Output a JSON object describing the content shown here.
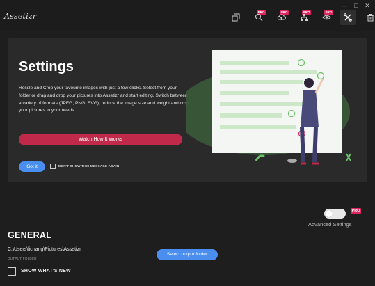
{
  "titlebar": {
    "logo": "Assetizr",
    "window_controls": {
      "minimize": "–",
      "maximize": "□",
      "close": "✕"
    },
    "pro_badge": "PRO",
    "icons": [
      "resize-icon",
      "search-optimize-icon",
      "cloud-upload-icon",
      "hierarchy-icon",
      "watermark-eye-icon",
      "tools-icon",
      "trash-icon"
    ]
  },
  "settings_card": {
    "title": "Settings",
    "description": "Resize and Crop your favourite images with just a few clicks. Select from your folder or drag and drop your pictures into Assetizr and start editing. Switch between a variety of formats (JPEG, PNG, SVG), reduce the image size and weight and crop your pictures to your needs.",
    "watch_button": "Watch How It Works",
    "got_it_button": "Got it",
    "dont_show_label": "DON'T SHOW THIS MESSAGE AGAIN",
    "dont_show_checked": false
  },
  "advanced": {
    "toggle_on": false,
    "pro_badge": "PRO",
    "label": "Advanced Settings"
  },
  "general": {
    "title": "GENERAL",
    "output_path": "C:\\Users\\lichang\\Pictures\\Assetizr",
    "output_caption": "OUTPUT FOLDER",
    "select_button": "Select output folder",
    "whats_new_label": "SHOW WHAT'S NEW",
    "whats_new_checked": false
  },
  "colors": {
    "background": "#1e1e1e",
    "card": "#2a2a2a",
    "accent_blue": "#4a8ff0",
    "accent_red": "#c0294a",
    "pro_pink": "#e0245e",
    "illustration_green": "#3a5a3a"
  }
}
